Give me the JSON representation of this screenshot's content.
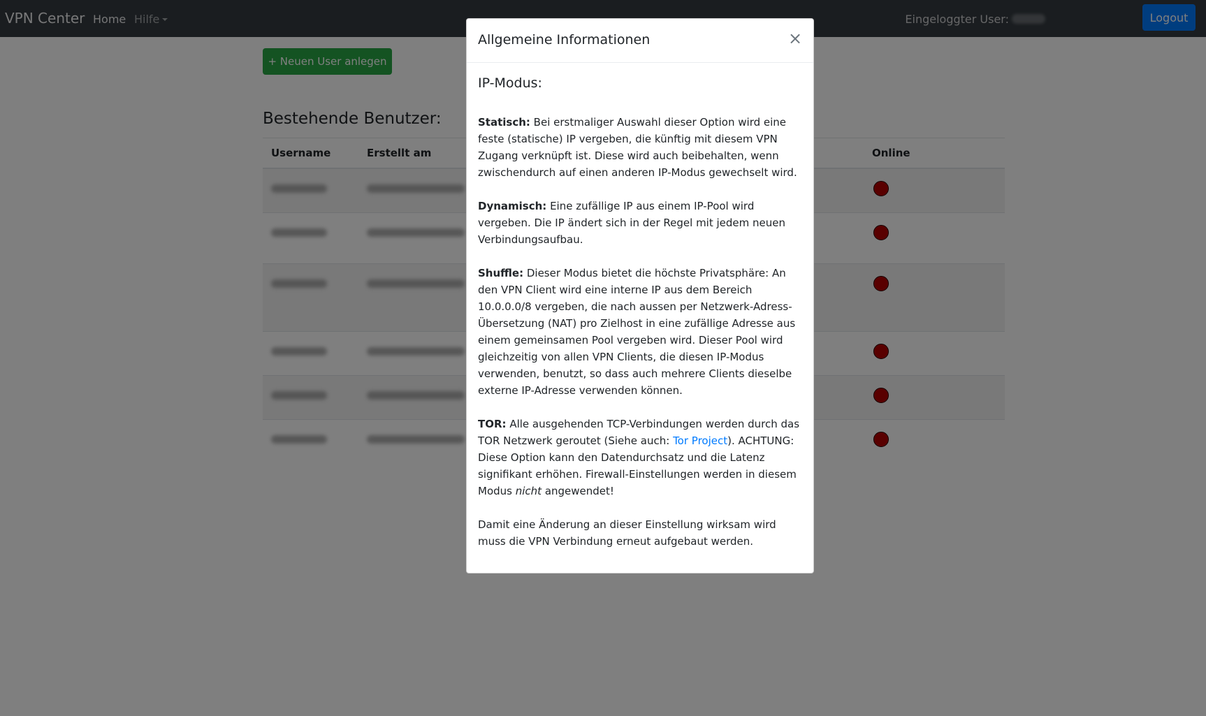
{
  "navbar": {
    "brand": "VPN Center",
    "home": "Home",
    "help": "Hilfe",
    "user_label": "Eingeloggter User:",
    "logout": "Logout"
  },
  "page": {
    "new_user_button": "+ Neuen User anlegen",
    "section_title": "Bestehende Benutzer:",
    "table": {
      "headers": {
        "username": "Username",
        "created": "Erstellt am",
        "online": "Online"
      },
      "rows": [
        {
          "online": false
        },
        {
          "online": false
        },
        {
          "online": false
        },
        {
          "online": false
        },
        {
          "online": false
        },
        {
          "online": false
        }
      ]
    }
  },
  "modal": {
    "title": "Allgemeine Informationen",
    "close": "×",
    "heading": "IP-Modus:",
    "static_label": "Statisch:",
    "static_text": " Bei erstmaliger Auswahl dieser Option wird eine feste (statische) IP vergeben, die künftig mit diesem VPN Zugang verknüpft ist. Diese wird auch beibehalten, wenn zwischendurch auf einen anderen IP-Modus gewechselt wird.",
    "dynamic_label": "Dynamisch:",
    "dynamic_text": " Eine zufällige IP aus einem IP-Pool wird vergeben. Die IP ändert sich in der Regel mit jedem neuen Verbindungsaufbau.",
    "shuffle_label": "Shuffle:",
    "shuffle_text": " Dieser Modus bietet die höchste Privatsphäre: An den VPN Client wird eine interne IP aus dem Bereich 10.0.0.0/8 vergeben, die nach aussen per Netzwerk-Adress-Übersetzung (NAT) pro Zielhost in eine zufällige Adresse aus einem gemeinsamen Pool vergeben wird. Dieser Pool wird gleichzeitig von allen VPN Clients, die diesen IP-Modus verwenden, benutzt, so dass auch mehrere Clients dieselbe externe IP-Adresse verwenden können.",
    "tor_label": "TOR:",
    "tor_text_1": " Alle ausgehenden TCP-Verbindungen werden durch das TOR Netzwerk geroutet (Siehe auch: ",
    "tor_link": "Tor Project",
    "tor_text_2": "). ACHTUNG: Diese Option kann den Datendurchsatz und die Latenz signifikant erhöhen. Firewall-Einstellungen werden in diesem Modus ",
    "tor_emphasis": "nicht",
    "tor_text_3": " angewendet!",
    "footer_note": "Damit eine Änderung an dieser Einstellung wirksam wird muss die VPN Verbindung erneut aufgebaut werden."
  },
  "colors": {
    "navbar": "#343a40",
    "logout": "#007bff",
    "new_user": "#28a745",
    "offline_dot": "#b30000",
    "link": "#007bff"
  }
}
